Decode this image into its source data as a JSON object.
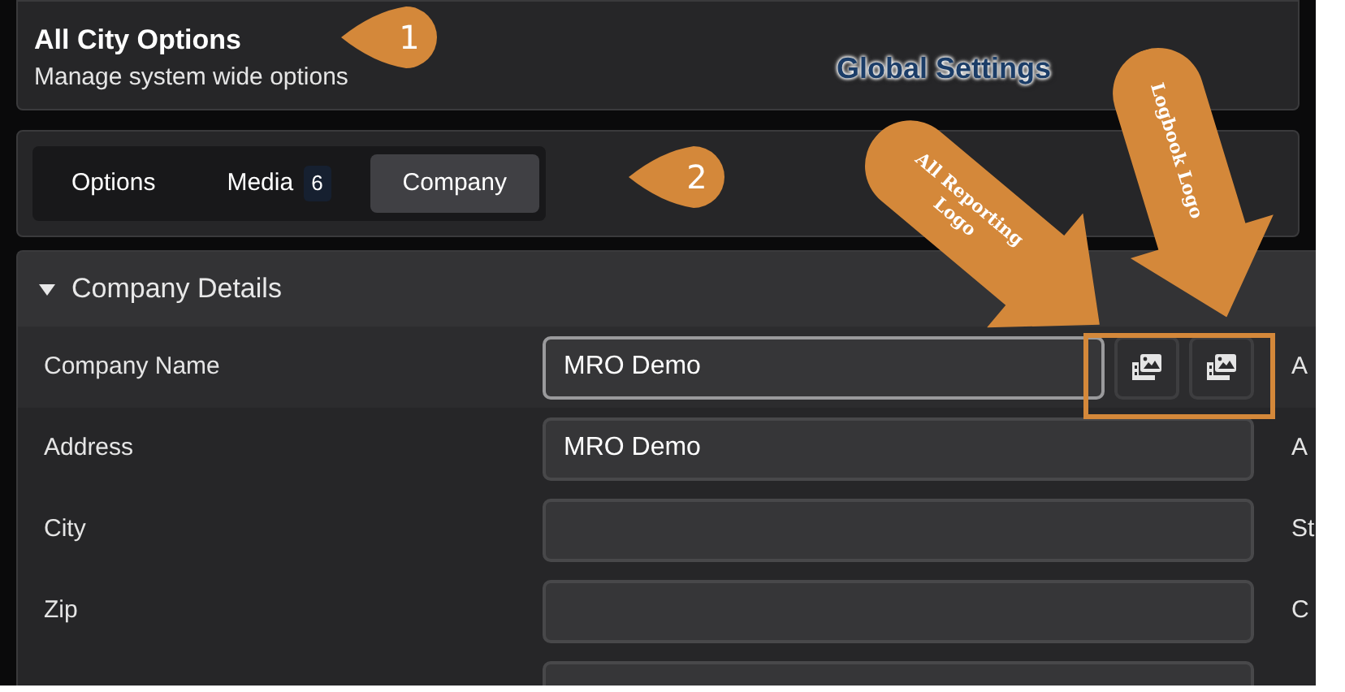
{
  "header": {
    "title": "All City Options",
    "subtitle": "Manage system wide options"
  },
  "tabs": [
    {
      "label": "Options",
      "selected": false
    },
    {
      "label": "Media",
      "badge": "6",
      "selected": false
    },
    {
      "label": "Company",
      "selected": true
    }
  ],
  "section": {
    "title": "Company Details",
    "expanded": true,
    "rows": [
      {
        "kind": "with_logo_buttons",
        "label": "Company Name",
        "value": "MRO Demo",
        "focused": true,
        "side_label": "A"
      },
      {
        "kind": "text",
        "label": "Address",
        "value": "MRO Demo",
        "focused": false,
        "side_label": "A"
      },
      {
        "kind": "text",
        "label": "City",
        "focused": false,
        "side_label": "St"
      },
      {
        "kind": "text",
        "label": "Zip",
        "focused": false,
        "side_label": "C"
      },
      {
        "kind": "text",
        "focused": false
      }
    ]
  },
  "annotations": {
    "step_markers": [
      "1",
      "2"
    ],
    "heading": "Global Settings",
    "arrows": [
      "All Reporting Logo",
      "Logbook Logo"
    ]
  }
}
